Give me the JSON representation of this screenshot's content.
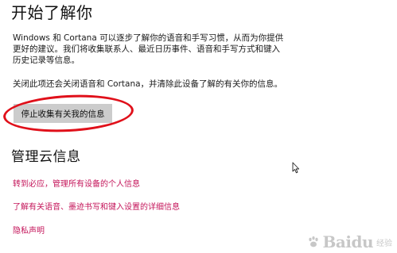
{
  "section1": {
    "title": "开始了解你",
    "paragraph1": "Windows 和 Cortana 可以逐步了解你的语音和手写习惯，从而为你提供更好的建议。我们将收集联系人、最近日历事件、语音和手写方式和键入历史记录等信息。",
    "paragraph2": "关闭此项还会关闭语音和 Cortana，并清除此设备了解的有关你的信息。",
    "button_label": "停止收集有关我的信息"
  },
  "section2": {
    "title": "管理云信息",
    "links": [
      "转到必应，管理所有设备的个人信息",
      "了解有关语音、墨迹书写和键入设置的详细信息",
      "隐私声明"
    ]
  },
  "watermark": {
    "logo_text": "Baidu",
    "sub_text": "经验"
  },
  "colors": {
    "link": "#c4155a",
    "annotation_ring": "#e0101a",
    "button_bg": "#cccccc"
  },
  "icons": [
    "mouse-pointer-icon",
    "baidu-paw-icon"
  ]
}
